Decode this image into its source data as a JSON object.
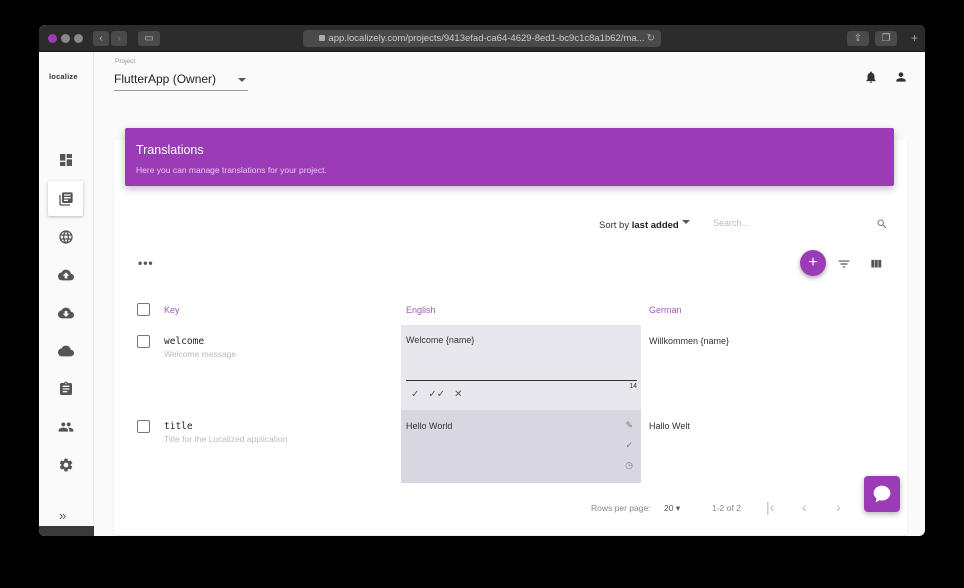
{
  "browser": {
    "url": "app.localizely.com/projects/9413efad-ca64-4629-8ed1-bc9c1c8a1b62/ma..."
  },
  "sidebar": {
    "logo": "localize",
    "items": [
      {
        "icon": "dashboard-icon"
      },
      {
        "icon": "translations-icon",
        "active": true
      },
      {
        "icon": "globe-icon"
      },
      {
        "icon": "upload-cloud-icon"
      },
      {
        "icon": "download-cloud-icon"
      },
      {
        "icon": "sync-cloud-icon"
      },
      {
        "icon": "clipboard-icon"
      },
      {
        "icon": "team-icon"
      },
      {
        "icon": "settings-icon"
      }
    ],
    "collapse": "»"
  },
  "header": {
    "project_label": "Project",
    "project_value": "FlutterApp (Owner)"
  },
  "banner": {
    "title": "Translations",
    "subtitle": "Here you can manage translations for your project."
  },
  "toolbar": {
    "sort_prefix": "Sort by ",
    "sort_value": "last added",
    "search_placeholder": "Search...",
    "more": "•••",
    "add": "+"
  },
  "table": {
    "headers": {
      "key": "Key",
      "english": "English",
      "german": "German"
    },
    "rows": [
      {
        "key": "welcome",
        "description": "Welcome message",
        "english": "Welcome {name}",
        "german": "Willkommen {name}",
        "char_count": "14"
      },
      {
        "key": "title",
        "description": "Title for the Localized application",
        "english": "Hello World",
        "german": "Hallo Welt"
      }
    ]
  },
  "pagination": {
    "rows_label": "Rows per page:",
    "rows_value": "20",
    "range": "1-2 of 2"
  },
  "colors": {
    "accent": "#9c3bb6"
  }
}
